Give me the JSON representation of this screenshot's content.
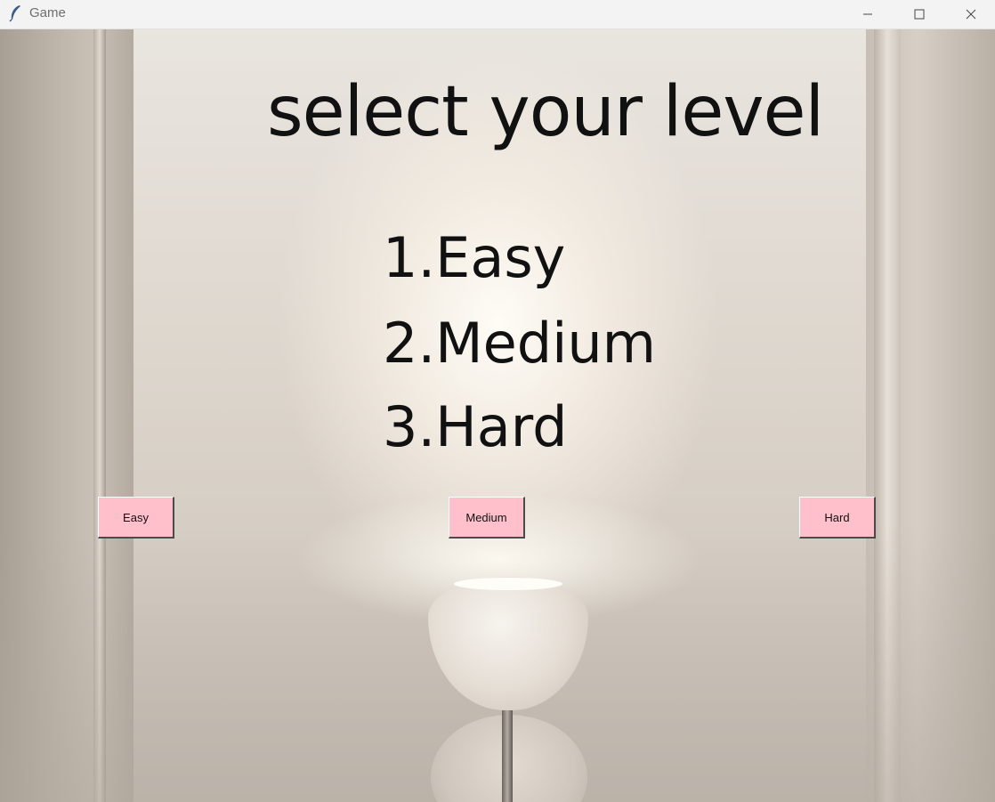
{
  "window": {
    "title": "Game",
    "icon": "feather-icon",
    "controls": {
      "minimize": "minimize-icon",
      "maximize": "maximize-icon",
      "close": "close-icon"
    }
  },
  "screen": {
    "heading": "select your level",
    "options": [
      "1.Easy",
      "2.Medium",
      "3.Hard"
    ],
    "buttons": {
      "easy": "Easy",
      "medium": "Medium",
      "hard": "Hard"
    }
  },
  "colors": {
    "button_bg": "#ffc0cb",
    "text": "#111111",
    "titlebar_bg": "#f3f3f3"
  }
}
